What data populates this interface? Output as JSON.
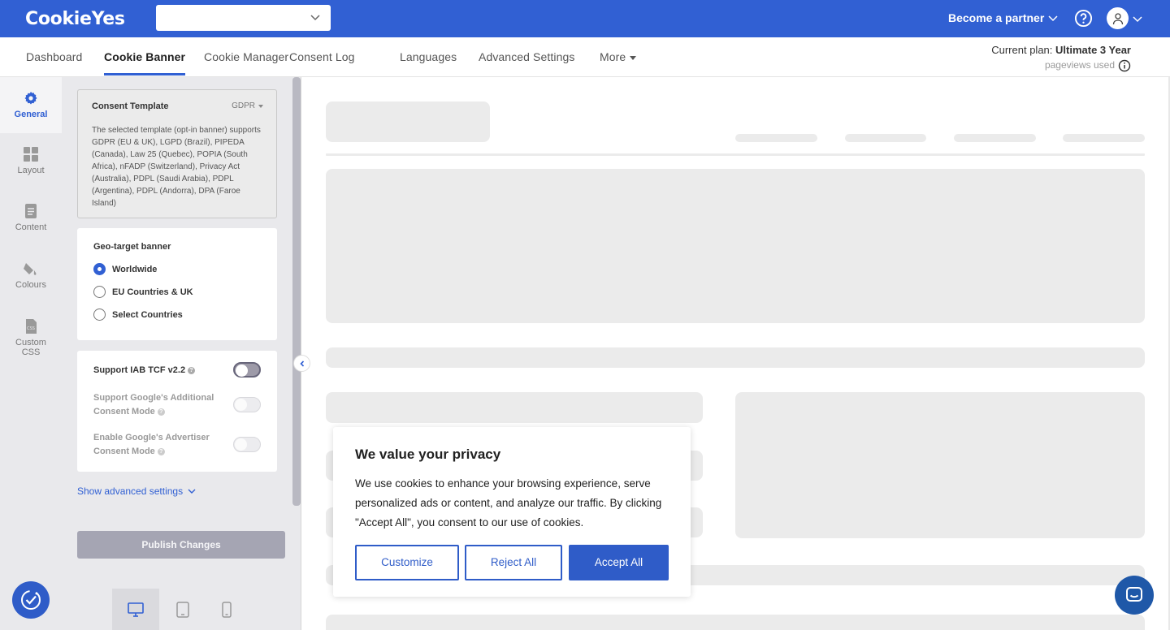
{
  "app": {
    "logo_text": "CookieYes",
    "partner_label": "Become a partner",
    "brand_color": "#3160d3"
  },
  "nav": {
    "tabs": [
      {
        "label": "Dashboard",
        "active": false
      },
      {
        "label": "Cookie Banner",
        "active": true
      },
      {
        "label": "Cookie Manager",
        "active": false
      },
      {
        "label": "Consent Log",
        "active": false
      },
      {
        "label": "Languages",
        "active": false
      },
      {
        "label": "Advanced Settings",
        "active": false
      },
      {
        "label": "More",
        "active": false
      }
    ],
    "plan_prefix": "Current plan:",
    "plan_name": "Ultimate 3 Year",
    "pageviews_label": "pageviews used"
  },
  "rail": {
    "items": [
      {
        "label": "General",
        "icon": "gear-icon",
        "active": true
      },
      {
        "label": "Layout",
        "icon": "layout-grid-icon",
        "active": false
      },
      {
        "label": "Content",
        "icon": "document-icon",
        "active": false
      },
      {
        "label": "Colours",
        "icon": "paint-bucket-icon",
        "active": false
      },
      {
        "label": "Custom CSS",
        "icon": "css-file-icon",
        "active": false
      }
    ]
  },
  "panel": {
    "template": {
      "title": "Consent Template",
      "selected": "GDPR",
      "description": "The selected template (opt-in banner) supports GDPR (EU & UK), LGPD (Brazil), PIPEDA (Canada), Law 25 (Quebec), POPIA (South Africa), nFADP (Switzerland), Privacy Act (Australia), PDPL (Saudi Arabia), PDPL (Argentina), PDPL (Andorra), DPA (Faroe Island)"
    },
    "geo": {
      "title": "Geo-target banner",
      "options": [
        {
          "label": "Worldwide",
          "checked": true
        },
        {
          "label": "EU Countries & UK",
          "checked": false
        },
        {
          "label": "Select Countries",
          "checked": false
        }
      ]
    },
    "toggles": [
      {
        "label": "Support IAB TCF v2.2",
        "enabled": true,
        "on": false
      },
      {
        "label": "Support Google's Additional Consent Mode",
        "enabled": false,
        "on": false
      },
      {
        "label": "Enable Google's Advertiser Consent Mode",
        "enabled": false,
        "on": false
      }
    ],
    "advanced_link": "Show advanced settings",
    "publish_label": "Publish Changes"
  },
  "devices": [
    "desktop",
    "tablet",
    "mobile"
  ],
  "cookie_banner": {
    "title": "We value your privacy",
    "body": "We use cookies to enhance your browsing experience, serve personalized ads or content, and analyze our traffic. By clicking \"Accept All\", you consent to our use of cookies.",
    "customize_label": "Customize",
    "reject_label": "Reject All",
    "accept_label": "Accept All",
    "button_color": "#2f5cc8"
  }
}
